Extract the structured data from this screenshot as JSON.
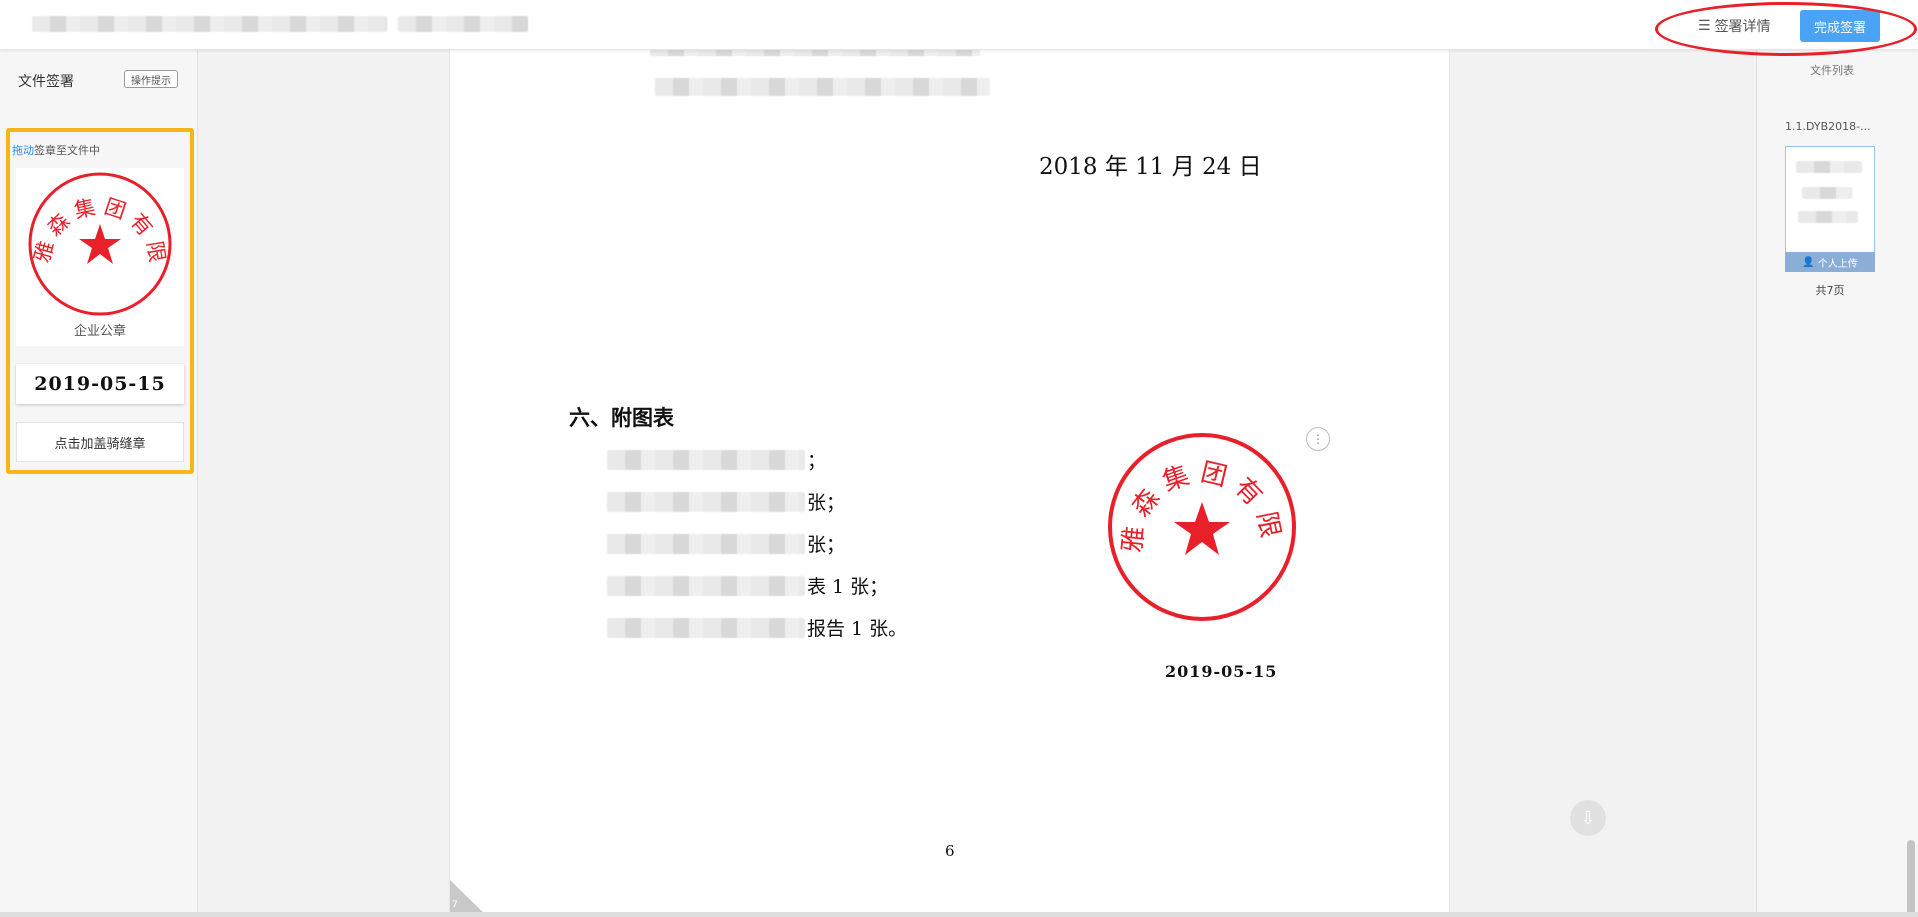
{
  "header": {
    "detail_label": "签署详情",
    "finish_label": "完成签署"
  },
  "left_panel": {
    "title": "文件签署",
    "op_tip": "操作提示",
    "drag_prefix": "拖动",
    "drag_suffix": "签章至文件中",
    "seal_name": "企业公章",
    "seal_arc_text": "雅森集团有限公司",
    "seal_date": "2019-05-15",
    "ride_button": "点击加盖骑缝章"
  },
  "document": {
    "date_line": "2018 年 11 月 24 日",
    "section_title": "六、附图表",
    "items": [
      "；",
      "张；",
      "张；",
      "表 1 张；",
      "报告 1 张。"
    ],
    "page_number": "6",
    "stamp_arc_text": "雅森集团有限公司",
    "stamp_date": "2019-05-15",
    "corner_page": "7"
  },
  "right_panel": {
    "title": "文件列表",
    "file_name": "1.1.DYB2018-...",
    "upload_label": "个人上传",
    "page_count": "共7页"
  },
  "colors": {
    "accent": "#4aa3f5",
    "seal_red": "#e8202a",
    "highlight": "#f7b518"
  }
}
